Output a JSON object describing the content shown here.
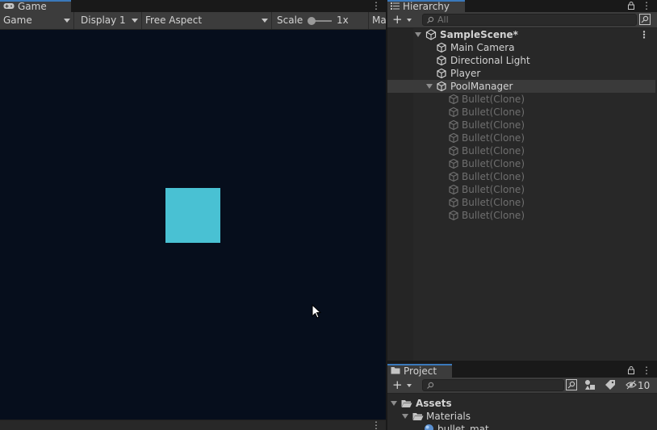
{
  "game": {
    "tab_label": "Game",
    "toolbar": {
      "mode": "Game",
      "display": "Display 1",
      "aspect": "Free Aspect",
      "scale_label": "Scale",
      "scale_value": "1x",
      "maximize_label": "Ma"
    },
    "colors": {
      "background": "#060e1c",
      "player": "#49c1d3"
    }
  },
  "hierarchy": {
    "tab_label": "Hierarchy",
    "search_placeholder": "All",
    "scene_name": "SampleScene*",
    "items": [
      {
        "label": "Main Camera"
      },
      {
        "label": "Directional Light"
      },
      {
        "label": "Player"
      },
      {
        "label": "PoolManager"
      }
    ],
    "children": [
      {
        "label": "Bullet(Clone)"
      },
      {
        "label": "Bullet(Clone)"
      },
      {
        "label": "Bullet(Clone)"
      },
      {
        "label": "Bullet(Clone)"
      },
      {
        "label": "Bullet(Clone)"
      },
      {
        "label": "Bullet(Clone)"
      },
      {
        "label": "Bullet(Clone)"
      },
      {
        "label": "Bullet(Clone)"
      },
      {
        "label": "Bullet(Clone)"
      },
      {
        "label": "Bullet(Clone)"
      }
    ]
  },
  "project": {
    "tab_label": "Project",
    "search_placeholder": "",
    "hidden_count": "10",
    "tree": [
      {
        "label": "Assets"
      },
      {
        "label": "Materials"
      },
      {
        "label": "bullet_mat"
      }
    ]
  }
}
